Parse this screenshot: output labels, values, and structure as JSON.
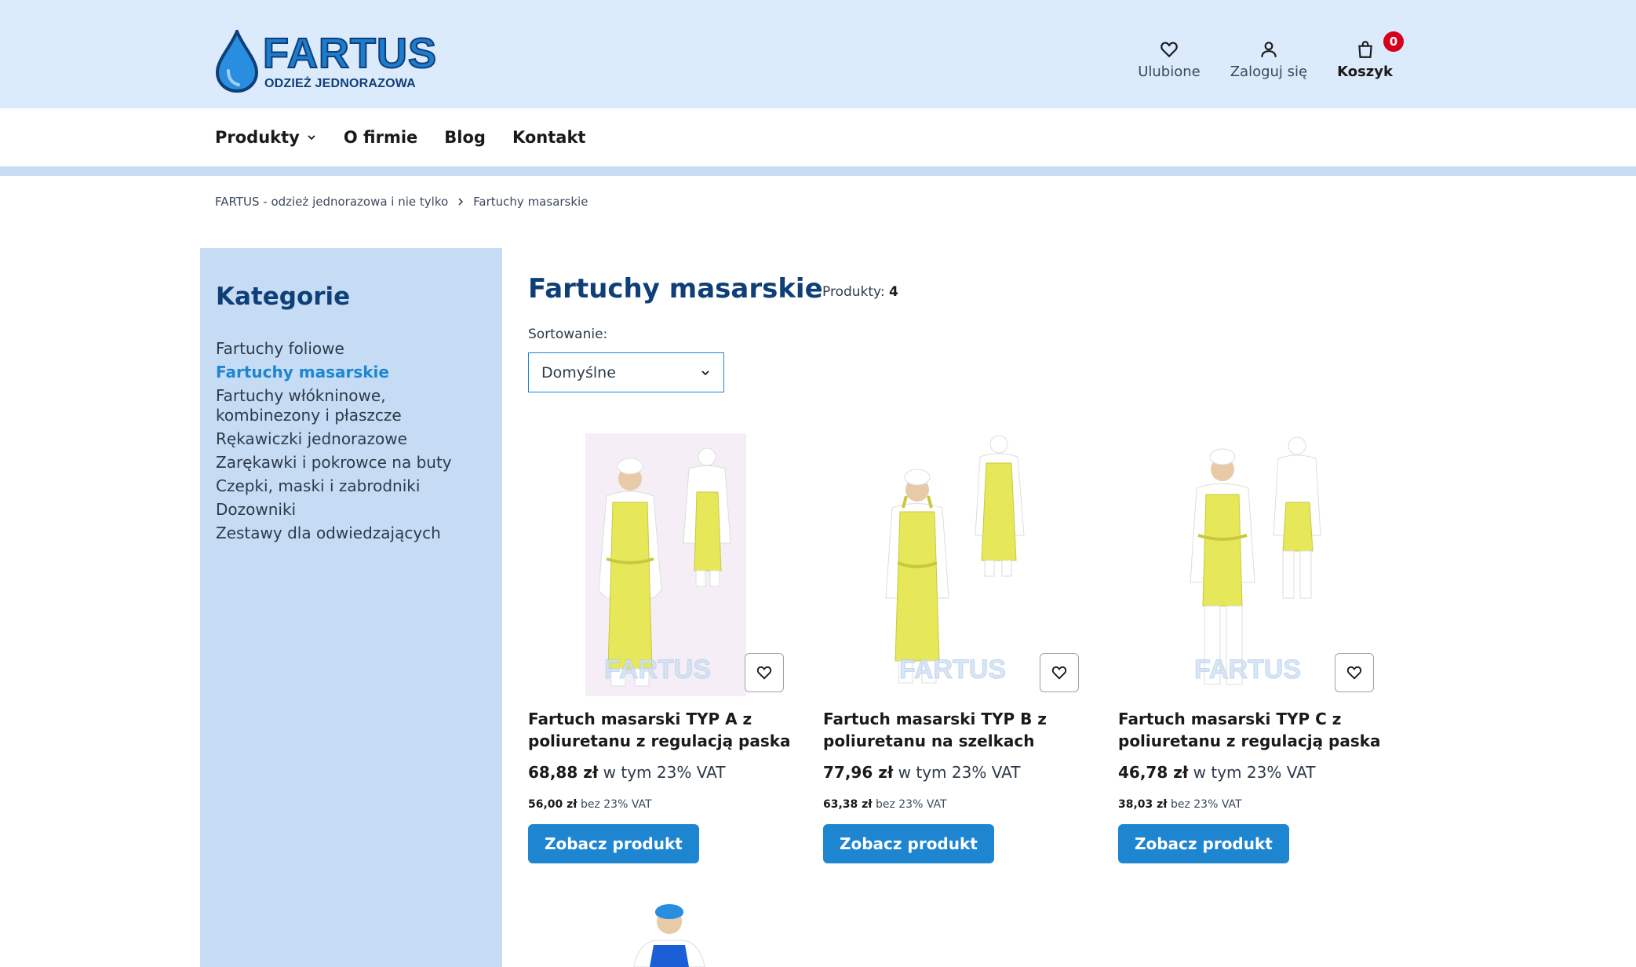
{
  "header": {
    "logo": {
      "brand": "FARTUS",
      "tagline": "ODZIEŻ JEDNORAZOWA"
    },
    "favorites_label": "Ulubione",
    "login_label": "Zaloguj się",
    "cart_label": "Koszyk",
    "cart_count": "0"
  },
  "nav": {
    "items": [
      {
        "label": "Produkty",
        "has_dropdown": true
      },
      {
        "label": "O firmie"
      },
      {
        "label": "Blog"
      },
      {
        "label": "Kontakt"
      }
    ]
  },
  "breadcrumb": {
    "home": "FARTUS - odzież jednorazowa i nie tylko",
    "current": "Fartuchy masarskie"
  },
  "sidebar": {
    "title": "Kategorie",
    "categories": [
      {
        "label": "Fartuchy foliowe",
        "active": false
      },
      {
        "label": "Fartuchy masarskie",
        "active": true
      },
      {
        "label": "Fartuchy włókninowe, kombinezony i płaszcze",
        "active": false
      },
      {
        "label": "Rękawiczki jednorazowe",
        "active": false
      },
      {
        "label": "Zarękawki i pokrowce na buty",
        "active": false
      },
      {
        "label": "Czepki, maski i zabrodniki",
        "active": false
      },
      {
        "label": "Dozowniki",
        "active": false
      },
      {
        "label": "Zestawy dla odwiedzających",
        "active": false
      }
    ]
  },
  "main": {
    "title": "Fartuchy masarskie",
    "count_label": "Produkty:",
    "count_value": "4",
    "sort_label": "Sortowanie:",
    "sort_value": "Domyślne",
    "products": [
      {
        "name": "Fartuch masarski TYP A z poliuretanu z regulacją paska",
        "price": "68,88 zł",
        "price_vat": "w tym 23% VAT",
        "net_price": "56,00 zł",
        "net_label": "bez 23% VAT",
        "button": "Zobacz produkt",
        "watermark": "FARTUS"
      },
      {
        "name": "Fartuch masarski TYP B z poliuretanu na szelkach",
        "price": "77,96 zł",
        "price_vat": "w tym 23% VAT",
        "net_price": "63,38 zł",
        "net_label": "bez 23% VAT",
        "button": "Zobacz produkt",
        "watermark": "FARTUS"
      },
      {
        "name": "Fartuch masarski TYP C z poliuretanu z regulacją paska",
        "price": "46,78 zł",
        "price_vat": "w tym 23% VAT",
        "net_price": "38,03 zł",
        "net_label": "bez 23% VAT",
        "button": "Zobacz produkt",
        "watermark": "FARTUS"
      }
    ]
  },
  "colors": {
    "header_bg": "#dcebfb",
    "sidebar_bg": "#c5dcf4",
    "accent": "#1e86d1",
    "title": "#0f3f78",
    "badge": "#d6001c",
    "apron_yellow": "#e6e85a",
    "apron_blue": "#1a5fd6"
  }
}
